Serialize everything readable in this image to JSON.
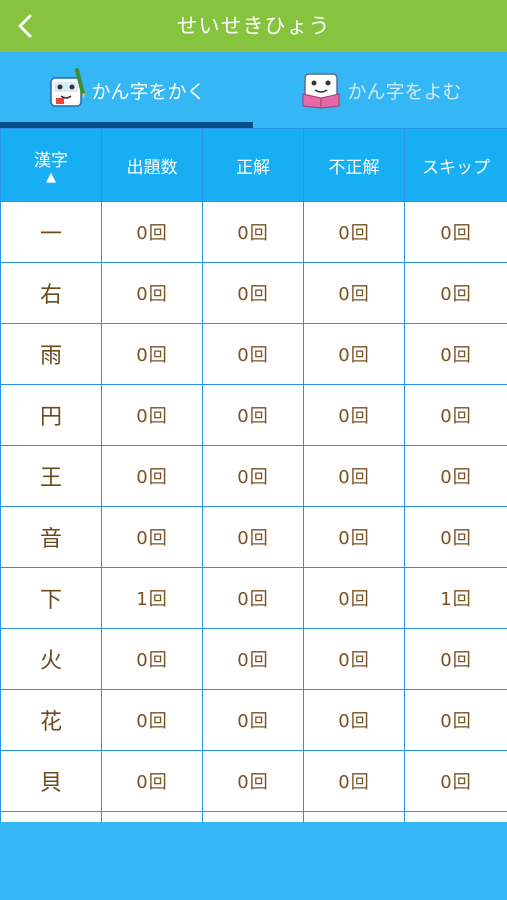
{
  "header": {
    "title": "せいせきひょう",
    "back_icon": "chevron-left-icon"
  },
  "tabs": [
    {
      "label": "かん字をかく",
      "icon": "kanji-write-character-icon",
      "active": true
    },
    {
      "label": "かん字をよむ",
      "icon": "kanji-read-character-icon",
      "active": false
    }
  ],
  "table": {
    "columns": [
      "漢字",
      "出題数",
      "正解",
      "不正解",
      "スキップ"
    ],
    "sort_indicator": "▲",
    "rows": [
      {
        "kanji": "一",
        "asked": "0回",
        "correct": "0回",
        "wrong": "0回",
        "skip": "0回"
      },
      {
        "kanji": "右",
        "asked": "0回",
        "correct": "0回",
        "wrong": "0回",
        "skip": "0回"
      },
      {
        "kanji": "雨",
        "asked": "0回",
        "correct": "0回",
        "wrong": "0回",
        "skip": "0回"
      },
      {
        "kanji": "円",
        "asked": "0回",
        "correct": "0回",
        "wrong": "0回",
        "skip": "0回"
      },
      {
        "kanji": "王",
        "asked": "0回",
        "correct": "0回",
        "wrong": "0回",
        "skip": "0回"
      },
      {
        "kanji": "音",
        "asked": "0回",
        "correct": "0回",
        "wrong": "0回",
        "skip": "0回"
      },
      {
        "kanji": "下",
        "asked": "1回",
        "correct": "0回",
        "wrong": "0回",
        "skip": "1回"
      },
      {
        "kanji": "火",
        "asked": "0回",
        "correct": "0回",
        "wrong": "0回",
        "skip": "0回"
      },
      {
        "kanji": "花",
        "asked": "0回",
        "correct": "0回",
        "wrong": "0回",
        "skip": "0回"
      },
      {
        "kanji": "貝",
        "asked": "0回",
        "correct": "0回",
        "wrong": "0回",
        "skip": "0回"
      }
    ]
  },
  "colors": {
    "header_bg": "#86c440",
    "tab_bg": "#35b7f5",
    "table_header_bg": "#17aef4",
    "grid_line": "#2a93e6",
    "active_indicator": "#0a4b8a",
    "cell_text": "#7a5224"
  }
}
